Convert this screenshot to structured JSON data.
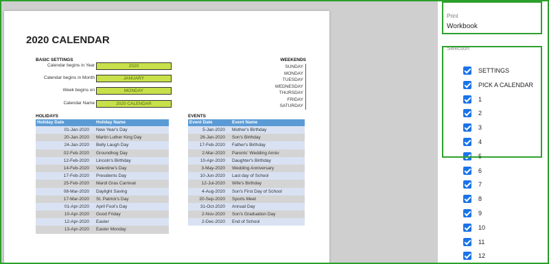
{
  "page": {
    "title": "2020 CALENDAR",
    "basic_settings": {
      "heading": "BASIC SETTINGS",
      "rows": [
        {
          "label": "Calendar begins in Year",
          "value": "2020"
        },
        {
          "label": "Calendar begins in Month",
          "value": "JANUARY"
        },
        {
          "label": "Week begins on",
          "value": "MONDAY"
        },
        {
          "label": "Calendar Name",
          "value": "2020 CALENDAR"
        }
      ]
    },
    "weekends": {
      "heading": "WEEKENDS",
      "days": [
        "SUNDAY",
        "MONDAY",
        "TUESDAY",
        "WEDNESDAY",
        "THURSDAY",
        "FRIDAY",
        "SATURDAY"
      ]
    },
    "holidays": {
      "heading": "HOLIDAYS",
      "col1": "Holiday Date",
      "col2": "Holiday Name",
      "rows": [
        {
          "date": "01-Jan-2020",
          "name": "New Year's Day"
        },
        {
          "date": "20-Jan-2020",
          "name": "Martin Luther King Day"
        },
        {
          "date": "24-Jan-2020",
          "name": "Belly Laugh Day"
        },
        {
          "date": "02-Feb-2020",
          "name": "Groundhog Day"
        },
        {
          "date": "12-Feb-2020",
          "name": "Lincoln's Birthday"
        },
        {
          "date": "14-Feb-2020",
          "name": "Valentine's Day"
        },
        {
          "date": "17-Feb-2020",
          "name": "Presidents Day"
        },
        {
          "date": "25-Feb-2020",
          "name": "Mardi Gras Carnival"
        },
        {
          "date": "08-Mar-2020",
          "name": "Daylight Saving"
        },
        {
          "date": "17-Mar-2020",
          "name": "St. Patrick's Day"
        },
        {
          "date": "01-Apr-2020",
          "name": "April Fool's Day"
        },
        {
          "date": "10-Apr-2020",
          "name": "Good Friday"
        },
        {
          "date": "12-Apr-2020",
          "name": "Easter"
        },
        {
          "date": "13-Apr-2020",
          "name": "Easter Monday"
        }
      ]
    },
    "events": {
      "heading": "EVENTS",
      "col1": "Event Date",
      "col2": "Event Name",
      "rows": [
        {
          "date": "5-Jan-2020",
          "name": "Mother's Birthday"
        },
        {
          "date": "26-Jan-2020",
          "name": "Son's Birthday"
        },
        {
          "date": "17-Feb-2020",
          "name": "Father's Birthday"
        },
        {
          "date": "2-Mar-2020",
          "name": "Parents' Wedding Anniv"
        },
        {
          "date": "10-Apr-2020",
          "name": "Daughter's Birthday"
        },
        {
          "date": "3-May-2020",
          "name": "Wedding Anniversary"
        },
        {
          "date": "10-Jun-2020",
          "name": "Last day of School"
        },
        {
          "date": "12-Jul-2020",
          "name": "Wife's Birthday"
        },
        {
          "date": "4-Aug-2020",
          "name": "Son's First Day of School"
        },
        {
          "date": "20-Sep-2020",
          "name": "Sports Meet"
        },
        {
          "date": "31-Oct-2020",
          "name": "Annual Day"
        },
        {
          "date": "2-Nov-2020",
          "name": "Son's Graduation Day"
        },
        {
          "date": "2-Dec-2020",
          "name": "End of School"
        }
      ]
    }
  },
  "panel": {
    "print_label": "Print",
    "print_value": "Workbook",
    "selection_label": "Selection",
    "items": [
      "SETTINGS",
      "PICK A CALENDAR",
      "1",
      "2",
      "3",
      "4",
      "5",
      "6",
      "7",
      "8",
      "9",
      "10",
      "11",
      "12"
    ]
  },
  "colors": {
    "accent": "#1a73e8",
    "highlight": "#2aa02a",
    "table_header": "#5b9bd5",
    "setting_value_bg": "#c8e04a"
  }
}
